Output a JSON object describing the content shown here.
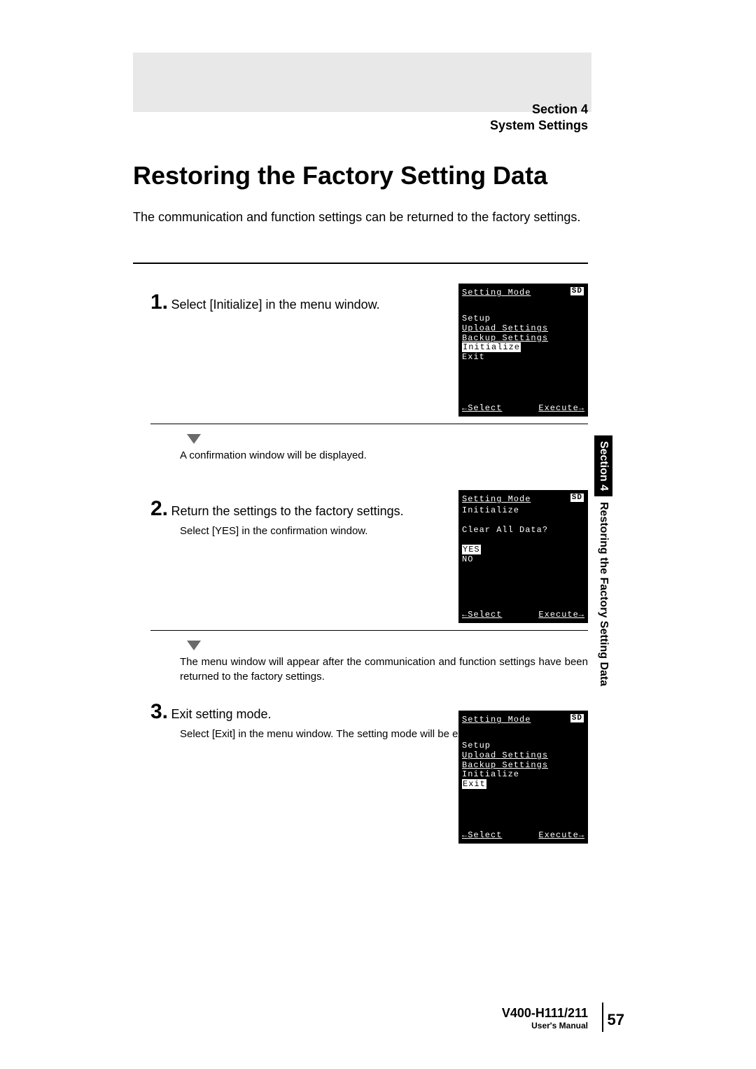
{
  "header": {
    "section": "Section 4",
    "subtitle": "System Settings"
  },
  "title": "Restoring the Factory Setting Data",
  "intro": "The communication and function settings can be returned to the factory settings.",
  "steps": [
    {
      "num": "1.",
      "title": "Select [Initialize] in the menu window.",
      "desc": "",
      "after_arrow_text": "A confirmation window will be displayed."
    },
    {
      "num": "2.",
      "title": "Return the settings to the factory settings.",
      "desc": "Select [YES] in the confirmation window.",
      "after_arrow_text": "The menu window will appear after the communication and function settings have been returned to the factory settings."
    },
    {
      "num": "3.",
      "title": "Exit setting mode.",
      "desc": "Select [Exit] in the menu window. The setting mode will be exited.",
      "after_arrow_text": ""
    }
  ],
  "lcd": {
    "sd_badge": "SD",
    "footer_left": "←Select",
    "footer_right": "Execute→",
    "screen1": {
      "title": "Setting Mode",
      "items": [
        "Setup",
        "Upload Settings",
        "Backup Settings",
        "Initialize",
        "Exit"
      ],
      "highlighted": "Initialize",
      "underlined": [
        "Upload Settings",
        "Backup Settings"
      ]
    },
    "screen2": {
      "title": "Setting Mode",
      "subtitle": "Initialize",
      "prompt": "Clear All Data?",
      "yes": "YES",
      "no": "NO"
    },
    "screen3": {
      "title": "Setting Mode",
      "items": [
        "Setup",
        "Upload Settings",
        "Backup Settings",
        "Initialize",
        "Exit"
      ],
      "highlighted": "Exit",
      "underlined": [
        "Upload Settings",
        "Backup Settings"
      ]
    }
  },
  "side_tab": {
    "black": "Section 4",
    "rest": "Restoring the Factory Setting Data"
  },
  "footer": {
    "model": "V400-H111/211",
    "manual": "User's Manual",
    "page": "57"
  }
}
